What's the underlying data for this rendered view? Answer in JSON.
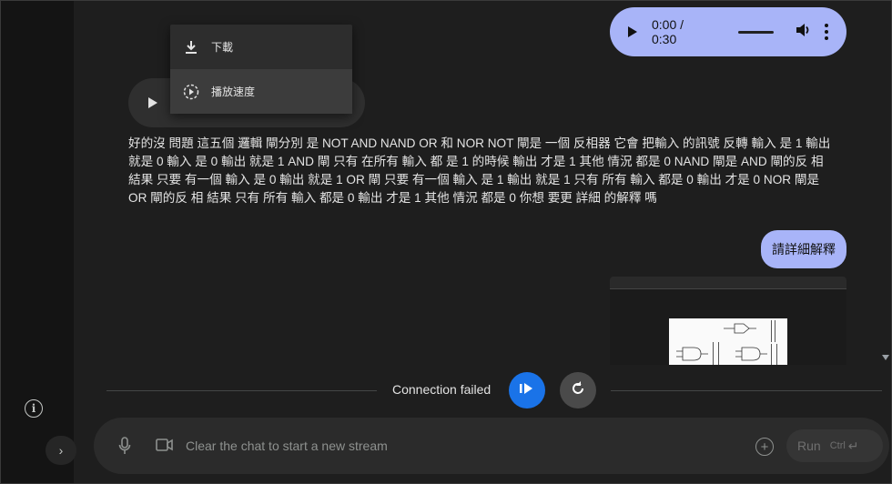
{
  "audio_user": {
    "time": "0:00 / 0:30",
    "progress": 0
  },
  "menu": {
    "items": [
      {
        "label": "下載",
        "icon": "download-icon"
      },
      {
        "label": "播放速度",
        "icon": "playback-speed-icon"
      }
    ]
  },
  "model_message": "好的沒 問題 這五個 邏輯 閘分別 是 NOT AND NAND OR 和 NOR NOT 閘是 一個 反相器 它會 把輸入 的訊號 反轉 輸入 是 1 輸出 就是 0 輸入 是 0 輸出 就是 1 AND 閘 只有 在所有 輸入 都 是 1 的時候 輸出 才是 1 其他 情況 都是 0 NAND 閘是 AND 閘的反 相 結果 只要 有一個 輸入 是 0 輸出 就是 1 OR 閘 只要 有一個 輸入 是 1 輸出 就是 1 只有 所有 輸入 都是 0 輸出 才是 0 NOR 閘是 OR 閘的反 相 結果 只有 所有 輸入 都是 0 輸出 才是 1 其他 情況 都是 0 你想 要更 詳細 的解釋 嗎",
  "user_message": "請詳細解釋",
  "status": {
    "text": "Connection failed"
  },
  "input": {
    "placeholder": "Clear the chat to start a new stream",
    "value": ""
  },
  "run_button": {
    "label": "Run",
    "shortcut": "Ctrl"
  },
  "colors": {
    "accent_bubble": "#a8b4f8",
    "primary_blue": "#1a73e8",
    "background": "#1e1e1e"
  }
}
